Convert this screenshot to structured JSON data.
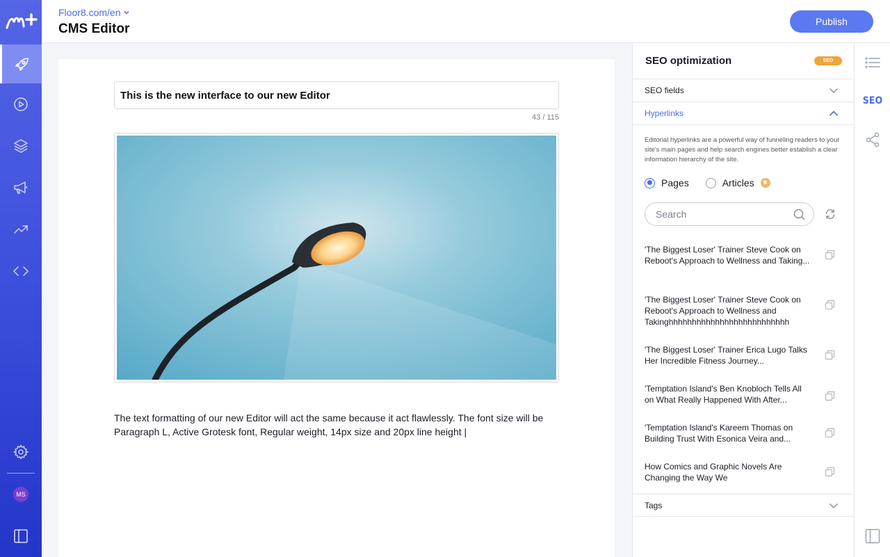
{
  "header": {
    "site": "Floor8.com/en",
    "title": "CMS Editor",
    "publish_label": "Publish"
  },
  "rail": {
    "avatar_initials": "MS"
  },
  "editor": {
    "title_value": "This is the new interface to our new Editor",
    "char_count": "43 / 115",
    "body_text": "The text formatting of our new Editor will act the same because it act flawlessly. The font size will be Paragraph L, Active Grotesk font, Regular weight, 14px size and 20px line height |"
  },
  "seo": {
    "title": "SEO optimization",
    "badge": "SEO",
    "sections": {
      "fields": "SEO fields",
      "hyperlinks": "Hyperlinks",
      "tags": "Tags"
    },
    "description": "Editorial hyperlinks are a powerful way of funneling readers to your site's main pages and help search engines better establish a clear information hierarchy of the site.",
    "radio_pages": "Pages",
    "radio_articles": "Articles",
    "search_placeholder": "Search",
    "links": [
      "'The Biggest Loser' Trainer Steve Cook on Reboot's Approach to Wellness and Taking...",
      "'The Biggest Loser' Trainer Steve Cook on Reboot's Approach to Wellness and Takinghhhhhhhhhhhhhhhhhhhhhhhhhh",
      "'The Biggest Loser' Trainer Erica Lugo Talks Her Incredible Fitness Journey...",
      "'Temptation Island's Ben Knobloch Tells All on What Really Happened With After...",
      "'Temptation Island's Kareem Thomas on Building Trust With Esonica Veira and...",
      "How Comics and Graphic Novels Are Changing the Way We"
    ]
  },
  "tools": {
    "seo_label": "SEO"
  }
}
